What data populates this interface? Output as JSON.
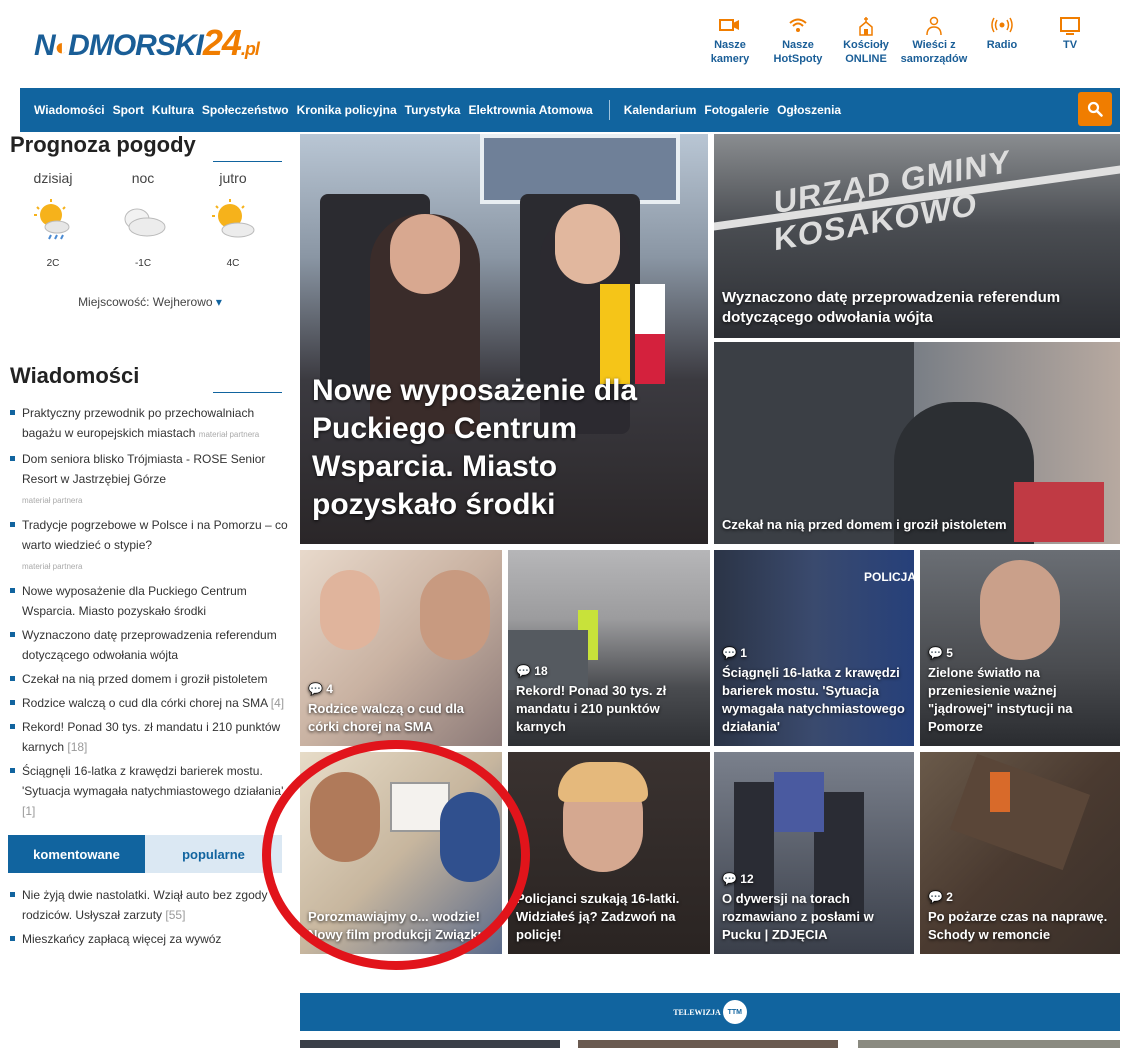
{
  "logo": {
    "part1": "N",
    "part1b": "DMORSKI",
    "part2": "24",
    "part3": ".pl"
  },
  "top_icons": [
    {
      "label": "Nasze kamery",
      "icon": "camera-icon",
      "glyph": "▭◂"
    },
    {
      "label": "Nasze HotSpoty",
      "icon": "wifi-icon",
      "glyph": "◠"
    },
    {
      "label": "Kościoły ONLINE",
      "icon": "church-icon",
      "glyph": "⛪"
    },
    {
      "label": "Wieści z samorządów",
      "icon": "people-icon",
      "glyph": "☺"
    },
    {
      "label": "Radio",
      "icon": "radio-icon",
      "glyph": "((•))"
    },
    {
      "label": "TV",
      "icon": "tv-icon",
      "glyph": "▭"
    }
  ],
  "nav": {
    "items_left": [
      "Wiadomości",
      "Sport",
      "Kultura",
      "Społeczeństwo",
      "Kronika policyjna",
      "Turystyka",
      "Elektrownia Atomowa"
    ],
    "items_right": [
      "Kalendarium",
      "Fotogalerie",
      "Ogłoszenia"
    ]
  },
  "weather": {
    "title": "Prognoza pogody",
    "days": [
      {
        "label": "dzisiaj",
        "temp": "2C",
        "icon": "sun-rain-cloud-icon"
      },
      {
        "label": "noc",
        "temp": "-1C",
        "icon": "cloud-icon"
      },
      {
        "label": "jutro",
        "temp": "4C",
        "icon": "sun-cloud-icon"
      }
    ],
    "location_label": "Miejscowość: Wejherowo",
    "location_arrow": "▾"
  },
  "news": {
    "title": "Wiadomości",
    "items": [
      {
        "text": "Praktyczny przewodnik po przechowalniach bagażu w europejskich miastach",
        "partner": "materiał partnera",
        "count": ""
      },
      {
        "text": "Dom seniora blisko Trójmiasta - ROSE Senior Resort w Jastrzębiej Górze",
        "partner": "materiał partnera",
        "count": ""
      },
      {
        "text": "Tradycje pogrzebowe w Polsce i na Pomorzu – co warto wiedzieć o stypie?",
        "partner": "materiał partnera",
        "count": ""
      },
      {
        "text": "Nowe wyposażenie dla Puckiego Centrum Wsparcia. Miasto pozyskało środki",
        "partner": "",
        "count": ""
      },
      {
        "text": "Wyznaczono datę przeprowadzenia referendum dotyczącego odwołania wójta",
        "partner": "",
        "count": ""
      },
      {
        "text": "Czekał na nią przed domem i groził pistoletem",
        "partner": "",
        "count": ""
      },
      {
        "text": "Rodzice walczą o cud dla córki chorej na SMA",
        "partner": "",
        "count": "[4]"
      },
      {
        "text": "Rekord! Ponad 30 tys. zł mandatu i 210 punktów karnych",
        "partner": "",
        "count": "[18]"
      },
      {
        "text": "Ściągnęli 16-latka z krawędzi barierek mostu. 'Sytuacja wymagała natychmiastowego działania'",
        "partner": "",
        "count": "[1]"
      }
    ]
  },
  "tabs": {
    "active": "komentowane",
    "inactive": "popularne"
  },
  "commented": [
    {
      "text": "Nie żyją dwie nastolatki. Wziął auto bez zgody rodziców. Usłyszał zarzuty",
      "count": "[55]"
    },
    {
      "text": "Mieszkańcy zapłacą więcej za wywóz",
      "count": ""
    }
  ],
  "tiles": {
    "main": {
      "title": "Nowe wyposażenie dla Puckiego Centrum Wsparcia. Miasto pozyskało środki"
    },
    "right_top": {
      "title": "Wyznaczono datę przeprowadzenia referendum dotyczącego odwołania wójta"
    },
    "right_bottom": {
      "title": "Czekał na nią przed domem i groził pistoletem"
    },
    "row1": [
      {
        "comments": "4",
        "title": "Rodzice walczą o cud dla córki chorej na SMA"
      },
      {
        "comments": "18",
        "title": "Rekord! Ponad 30 tys. zł mandatu i 210 punktów karnych"
      },
      {
        "comments": "1",
        "title": "Ściągnęli 16-latka z krawędzi barierek mostu. 'Sytuacja wymagała natychmiastowego działania'"
      },
      {
        "comments": "5",
        "title": "Zielone światło na przeniesienie ważnej \"jądrowej\" instytucji na Pomorze"
      }
    ],
    "row2": [
      {
        "comments": "",
        "title": "Porozmawiajmy o... wodzie! Nowy film produkcji Związku"
      },
      {
        "comments": "",
        "title": "Policjanci szukają 16-latki. Widziałeś ją? Zadzwoń na policję!"
      },
      {
        "comments": "12",
        "title": "O dywersji na torach rozmawiano z posłami w Pucku | ZDJĘCIA"
      },
      {
        "comments": "2",
        "title": "Po pożarze czas na naprawę. Schody w remoncie"
      }
    ]
  },
  "tv": {
    "label": "TELEWIZJA",
    "logo": "TTM"
  },
  "colors": {
    "brand_blue": "#11649f",
    "accent_orange": "#f07d00",
    "annotation_red": "#e1141b"
  }
}
